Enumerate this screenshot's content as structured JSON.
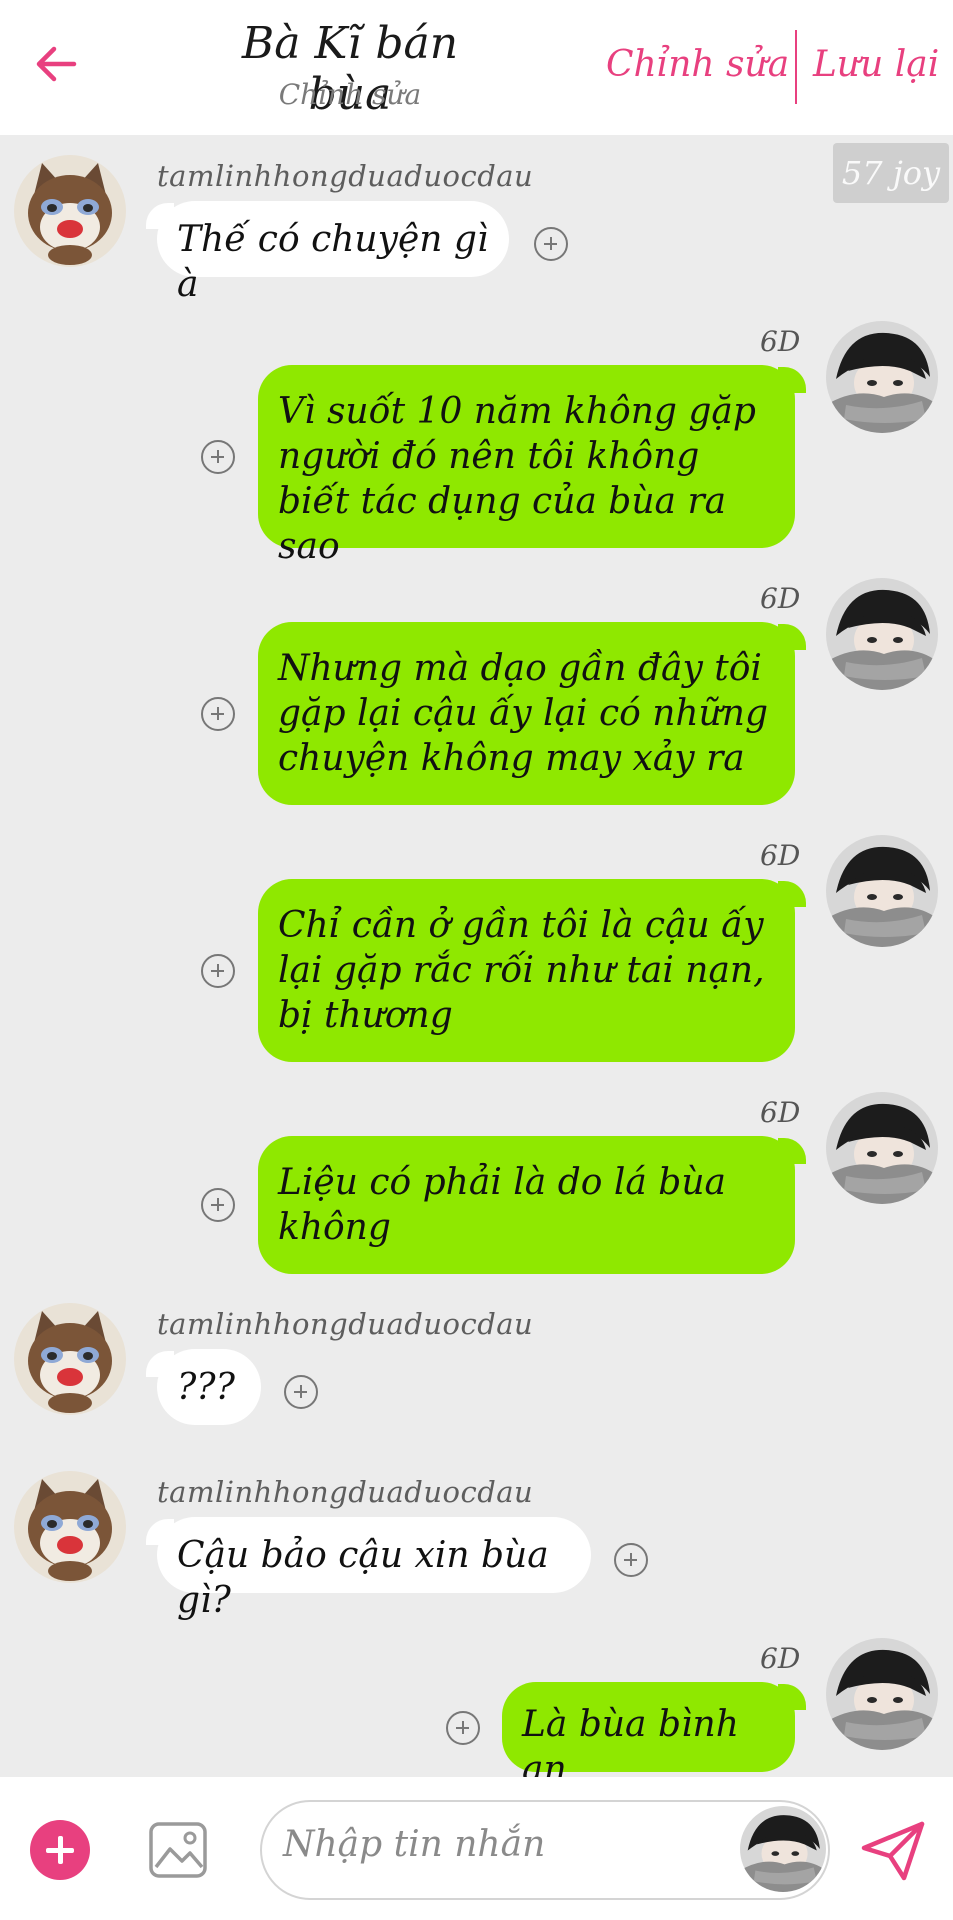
{
  "header": {
    "title": "Bà Kĩ bán bùa",
    "subtitle": "Chỉnh sửa",
    "edit_label": "Chỉnh sửa",
    "save_label": "Lưu lại"
  },
  "chat": {
    "joy_badge": "57 joy",
    "time_label": "6D",
    "messages": [
      {
        "side": "left",
        "sender": "tamlinhhongduaduocdau",
        "text": "Thế có chuyện gì à"
      },
      {
        "side": "right",
        "text": "Vì suốt 10 năm không gặp người đó nên tôi không biết tác dụng của bùa ra sao"
      },
      {
        "side": "right",
        "text": "Nhưng mà dạo gần đây tôi gặp lại cậu ấy lại có những chuyện không may xảy ra"
      },
      {
        "side": "right",
        "text": "Chỉ cần ở gần tôi là cậu ấy lại gặp rắc rối như tai nạn, bị thương"
      },
      {
        "side": "right",
        "text": "Liệu có phải là do lá bùa không"
      },
      {
        "side": "left",
        "sender": "tamlinhhongduaduocdau",
        "text": "???"
      },
      {
        "side": "left",
        "sender": "tamlinhhongduaduocdau",
        "text": "Cậu bảo cậu xin bùa gì?"
      },
      {
        "side": "right",
        "text": "Là bùa bình an"
      }
    ]
  },
  "composer": {
    "placeholder": "Nhập tin nhắn"
  },
  "icons": {
    "back": "arrow-left-icon",
    "add": "plus-circle-icon",
    "image": "image-icon",
    "send": "send-icon"
  },
  "colors": {
    "accent": "#e8407f",
    "my_bubble": "#8fe800",
    "their_bubble": "#ffffff",
    "background": "#ececec"
  }
}
